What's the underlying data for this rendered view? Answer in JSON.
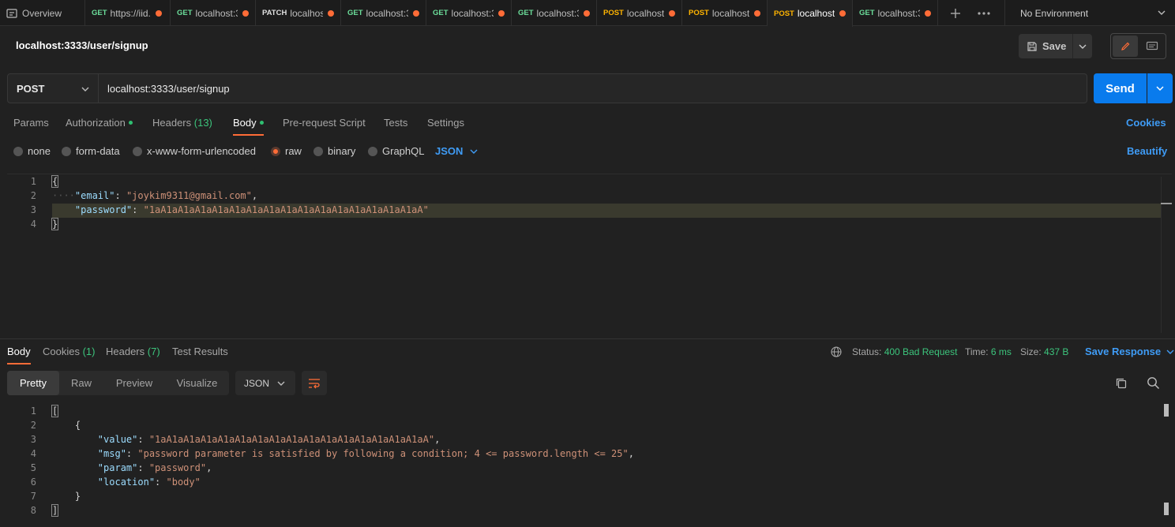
{
  "tabs": [
    {
      "method": "",
      "label": "Overview",
      "kind": "overview"
    },
    {
      "method": "GET",
      "label": "https://iid.",
      "kind": "get"
    },
    {
      "method": "GET",
      "label": "localhost:3",
      "kind": "get"
    },
    {
      "method": "PATCH",
      "label": "localhos",
      "kind": "patch"
    },
    {
      "method": "GET",
      "label": "localhost:3",
      "kind": "get"
    },
    {
      "method": "GET",
      "label": "localhost:3",
      "kind": "get"
    },
    {
      "method": "GET",
      "label": "localhost:3",
      "kind": "get"
    },
    {
      "method": "POST",
      "label": "localhost",
      "kind": "post"
    },
    {
      "method": "POST",
      "label": "localhost",
      "kind": "post"
    },
    {
      "method": "POST",
      "label": "localhost",
      "kind": "post",
      "active": true
    },
    {
      "method": "GET",
      "label": "localhost:3",
      "kind": "get"
    }
  ],
  "environment": "No Environment",
  "request": {
    "title": "localhost:3333/user/signup",
    "save_label": "Save",
    "method": "POST",
    "url": "localhost:3333/user/signup",
    "send_label": "Send"
  },
  "request_tabs": {
    "params": "Params",
    "authorization": "Authorization",
    "headers": "Headers",
    "headers_count": "(13)",
    "body": "Body",
    "prerequest": "Pre-request Script",
    "tests": "Tests",
    "settings": "Settings",
    "cookies": "Cookies"
  },
  "body_types": {
    "none": "none",
    "form_data": "form-data",
    "urlencoded": "x-www-form-urlencoded",
    "raw": "raw",
    "binary": "binary",
    "graphql": "GraphQL",
    "language": "JSON",
    "beautify": "Beautify"
  },
  "request_body": {
    "line_numbers": [
      "1",
      "2",
      "3",
      "4"
    ],
    "open_brace": "{",
    "close_brace": "}",
    "email_key": "\"email\"",
    "email_value": "\"joykim9311@gmail.com\"",
    "password_key": "\"password\"",
    "password_value": "\"1aA1aA1aA1aA1aA1aA1aA1aA1aA1aA1aA1aA1aA1aA1aA1aA\""
  },
  "response_tabs": {
    "body": "Body",
    "cookies": "Cookies",
    "cookies_count": "(1)",
    "headers": "Headers",
    "headers_count": "(7)",
    "test_results": "Test Results"
  },
  "response_status": {
    "status_label": "Status:",
    "status_value": "400 Bad Request",
    "time_label": "Time:",
    "time_value": "6 ms",
    "size_label": "Size:",
    "size_value": "437 B",
    "save_response": "Save Response"
  },
  "response_view": {
    "pretty": "Pretty",
    "raw": "Raw",
    "preview": "Preview",
    "visualize": "Visualize",
    "format": "JSON"
  },
  "response_body": {
    "line_numbers": [
      "1",
      "2",
      "3",
      "4",
      "5",
      "6",
      "7",
      "8"
    ],
    "open_bracket": "[",
    "close_bracket": "]",
    "open_brace": "{",
    "close_brace": "}",
    "value_key": "\"value\"",
    "value_value": "\"1aA1aA1aA1aA1aA1aA1aA1aA1aA1aA1aA1aA1aA1aA1aA1aA\"",
    "msg_key": "\"msg\"",
    "msg_value": "\"password parameter is satisfied by following a condition; 4 <= password.length <= 25\"",
    "param_key": "\"param\"",
    "param_value": "\"password\"",
    "location_key": "\"location\"",
    "location_value": "\"body\""
  },
  "colors": {
    "accent": "#ff6c37",
    "send": "#097bed",
    "link": "#3f9cf6",
    "success": "#3cc47c"
  }
}
